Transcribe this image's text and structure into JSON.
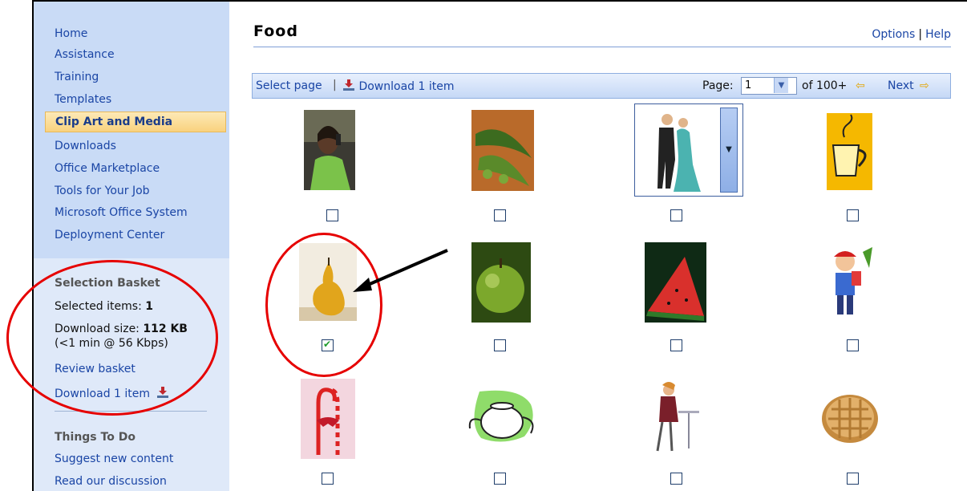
{
  "sidebar": {
    "nav": [
      "Home",
      "Assistance",
      "Training",
      "Templates",
      "Clip Art and Media",
      "Downloads",
      "Office Marketplace",
      "Tools for Your Job",
      "Microsoft Office System",
      "Deployment Center"
    ],
    "active_index": 4,
    "basket": {
      "heading": "Selection Basket",
      "selected_label": "Selected items: ",
      "selected_value": "1",
      "size_label": "Download size: ",
      "size_value": "112 KB",
      "size_note": "(<1 min @ 56 Kbps)",
      "review_link": "Review basket",
      "download_link": "Download 1 item"
    },
    "todo": {
      "heading": "Things To Do",
      "links": [
        "Suggest new content",
        "Read our discussion"
      ]
    }
  },
  "main": {
    "title": "Food",
    "options": "Options",
    "help": "Help",
    "toolbar": {
      "select_page": "Select page",
      "download": "Download 1 item",
      "page_label": "Page:",
      "page_value": "1",
      "of_label": "of 100+",
      "next": "Next"
    }
  },
  "thumbnails": [
    {
      "subject": "woman-on-phone",
      "checked": false
    },
    {
      "subject": "pea-pods",
      "checked": false
    },
    {
      "subject": "dancing-couple",
      "checked": false
    },
    {
      "subject": "coffee-cup",
      "checked": false
    },
    {
      "subject": "pear",
      "checked": true
    },
    {
      "subject": "green-apple",
      "checked": false
    },
    {
      "subject": "watermelon",
      "checked": false
    },
    {
      "subject": "boy-with-popcorn",
      "checked": false
    },
    {
      "subject": "candy-canes",
      "checked": false
    },
    {
      "subject": "teapot",
      "checked": false
    },
    {
      "subject": "woman-at-cafe-table",
      "checked": false
    },
    {
      "subject": "pie",
      "checked": false
    }
  ],
  "colors": {
    "link": "#1a45a5",
    "annotation": "#e60000",
    "sidebar_bg": "#c9dbf6"
  }
}
